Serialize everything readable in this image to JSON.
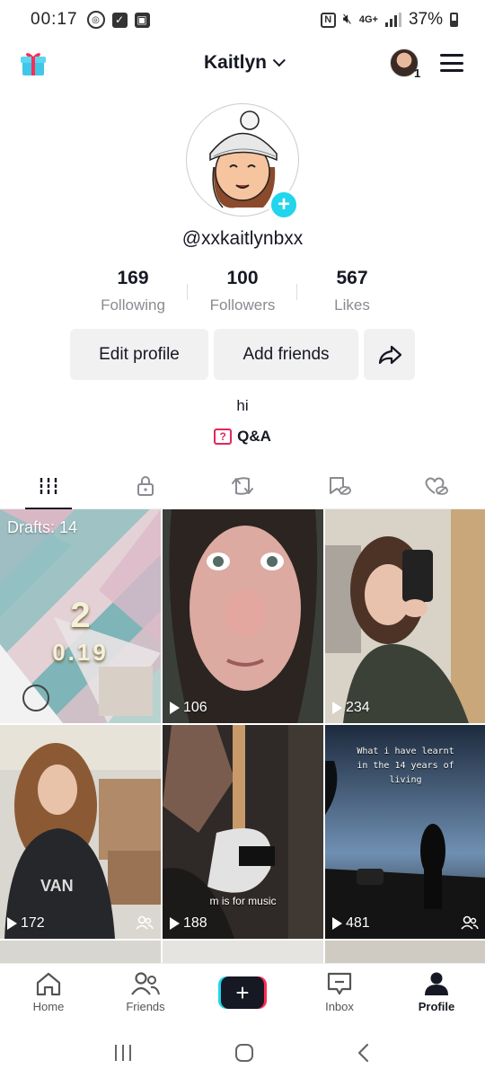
{
  "status_bar": {
    "time": "00:17",
    "network": "4G+",
    "battery": "37%"
  },
  "header": {
    "title": "Kaitlyn",
    "notification_count": "1"
  },
  "profile": {
    "handle": "@xxkaitlynbxx",
    "bio": "hi",
    "qa_label": "Q&A",
    "stats": [
      {
        "value": "169",
        "label": "Following"
      },
      {
        "value": "100",
        "label": "Followers"
      },
      {
        "value": "567",
        "label": "Likes"
      }
    ],
    "buttons": {
      "edit": "Edit profile",
      "add": "Add friends"
    }
  },
  "tabs": [
    {
      "icon": "videos-grid-icon",
      "active": true
    },
    {
      "icon": "lock-icon",
      "active": false
    },
    {
      "icon": "repost-icon",
      "active": false
    },
    {
      "icon": "bookmark-hidden-icon",
      "active": false
    },
    {
      "icon": "liked-hidden-icon",
      "active": false
    }
  ],
  "videos": [
    {
      "drafts": "Drafts: 14",
      "overlay": "2",
      "overlay2": "0.19"
    },
    {
      "views": "106"
    },
    {
      "views": "234"
    },
    {
      "views": "172",
      "friends_only": true
    },
    {
      "views": "188",
      "caption": "m is for music"
    },
    {
      "views": "481",
      "friends_only": true,
      "caption_lines": [
        "What i have learnt",
        "in the 14 years of",
        "living"
      ]
    }
  ],
  "bottom_nav": {
    "home": "Home",
    "friends": "Friends",
    "inbox": "Inbox",
    "profile": "Profile"
  },
  "colors": {
    "accent_cyan": "#20d5ec",
    "accent_red": "#fe2c55",
    "qa_red": "#e1275b",
    "text": "#161823"
  }
}
